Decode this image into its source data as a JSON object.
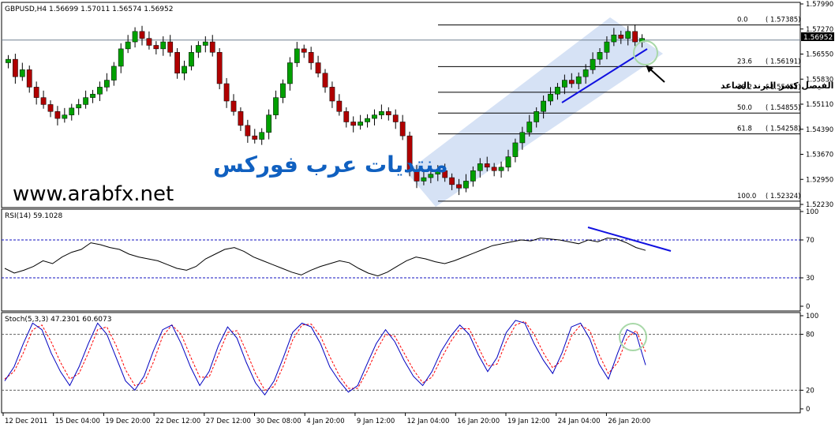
{
  "colors": {
    "background": "#ffffff",
    "candle_bull": "#00a000",
    "candle_bear": "#b00000",
    "candle_wick": "#000000",
    "channel_fill": "#c8d8f2",
    "trendline": "#1010e0",
    "fib_line": "#000000",
    "price_line": "#708090",
    "rsi_line": "#000000",
    "stoch_main": "#0000c0",
    "stoch_signal": "#ff0000",
    "level_dash": "#1010c0",
    "circle": "#a8d8a8",
    "watermark_arabic": "#1060c0",
    "watermark_url": "#000000"
  },
  "price_panel": {
    "header": "GBPUSD,H4  1.56699 1.57011 1.56574 1.56952",
    "current_price_label": "1.56952",
    "annotation": "الفيصل كسر الترند الصاعد",
    "watermark_arabic": "منتديات عرب فوركس",
    "watermark_url": "www.arabfx.net"
  },
  "rsi_panel": {
    "header": "RSI(14) 59.1028"
  },
  "stoch_panel": {
    "header": "Stoch(5,3,3) 47.2301 60.6073"
  },
  "chart_data": [
    {
      "type": "candlestick",
      "symbol": "GBPUSD",
      "timeframe": "H4",
      "ylim": [
        1.5223,
        1.5799
      ],
      "y_ticks": [
        "1.57990",
        "1.57270",
        "1.56550",
        "1.55830",
        "1.55110",
        "1.54390",
        "1.53670",
        "1.52950",
        "1.52230"
      ],
      "current_price": 1.56952,
      "fibonacci": [
        {
          "level": "0.0",
          "price": "1.57385",
          "value": 1.57385
        },
        {
          "level": "23.6",
          "price": "1.56191",
          "value": 1.56191
        },
        {
          "level": "38.2",
          "price": "1.55452",
          "value": 1.55452
        },
        {
          "level": "50.0",
          "price": "1.54855",
          "value": 1.54855
        },
        {
          "level": "61.8",
          "price": "1.54258",
          "value": 1.54258
        },
        {
          "level": "100.0",
          "price": "1.52324",
          "value": 1.52324
        }
      ],
      "close_series_approx": [
        1.564,
        1.559,
        1.561,
        1.556,
        1.553,
        1.551,
        1.549,
        1.547,
        1.548,
        1.55,
        1.551,
        1.553,
        1.554,
        1.556,
        1.558,
        1.562,
        1.567,
        1.569,
        1.572,
        1.57,
        1.568,
        1.567,
        1.569,
        1.566,
        1.56,
        1.562,
        1.566,
        1.568,
        1.569,
        1.566,
        1.557,
        1.552,
        1.549,
        1.545,
        1.542,
        1.541,
        1.543,
        1.548,
        1.553,
        1.557,
        1.563,
        1.567,
        1.566,
        1.563,
        1.56,
        1.556,
        1.552,
        1.549,
        1.546,
        1.545,
        1.546,
        1.547,
        1.548,
        1.549,
        1.548,
        1.546,
        1.542,
        1.532,
        1.529,
        1.53,
        1.531,
        1.532,
        1.53,
        1.528,
        1.527,
        1.529,
        1.532,
        1.534,
        1.533,
        1.532,
        1.533,
        1.536,
        1.54,
        1.543,
        1.546,
        1.549,
        1.552,
        1.554,
        1.556,
        1.558,
        1.557,
        1.559,
        1.561,
        1.564,
        1.566,
        1.569,
        1.571,
        1.57,
        1.572,
        1.569,
        1.57
      ]
    },
    {
      "type": "line",
      "name": "RSI(14)",
      "value": 59.1028,
      "ylim": [
        0,
        100
      ],
      "y_ticks": [
        "100",
        "70",
        "30",
        "0"
      ],
      "levels": [
        70,
        30
      ],
      "values_approx": [
        40,
        35,
        38,
        42,
        48,
        45,
        52,
        57,
        60,
        67,
        65,
        62,
        60,
        55,
        52,
        50,
        48,
        44,
        40,
        38,
        42,
        50,
        55,
        60,
        62,
        58,
        52,
        48,
        44,
        40,
        36,
        33,
        38,
        42,
        45,
        48,
        46,
        40,
        35,
        32,
        36,
        42,
        48,
        52,
        50,
        47,
        45,
        48,
        52,
        56,
        60,
        64,
        66,
        68,
        70,
        69,
        72,
        71,
        70,
        68,
        66,
        70,
        68,
        72,
        71,
        67,
        62,
        59
      ]
    },
    {
      "type": "line",
      "name": "Stoch(5,3,3)",
      "main": 47.2301,
      "signal": 60.6073,
      "ylim": [
        0,
        100
      ],
      "y_ticks": [
        "100",
        "80",
        "20",
        "0"
      ],
      "levels": [
        80,
        20
      ],
      "main_values_approx": [
        30,
        45,
        70,
        92,
        85,
        60,
        40,
        25,
        45,
        70,
        92,
        80,
        55,
        30,
        20,
        35,
        62,
        85,
        90,
        70,
        45,
        25,
        40,
        68,
        88,
        76,
        50,
        28,
        15,
        30,
        55,
        82,
        92,
        88,
        70,
        45,
        30,
        18,
        25,
        48,
        70,
        85,
        72,
        52,
        35,
        25,
        40,
        62,
        78,
        90,
        80,
        58,
        40,
        55,
        82,
        95,
        92,
        70,
        52,
        38,
        60,
        88,
        92,
        75,
        48,
        32,
        60,
        85,
        80,
        47
      ],
      "signal_values_approx": [
        32,
        40,
        60,
        85,
        90,
        72,
        50,
        32,
        38,
        60,
        85,
        88,
        68,
        42,
        25,
        28,
        50,
        78,
        90,
        80,
        56,
        34,
        34,
        58,
        82,
        84,
        62,
        38,
        20,
        24,
        46,
        74,
        90,
        91,
        78,
        56,
        36,
        22,
        22,
        40,
        62,
        80,
        78,
        60,
        42,
        28,
        34,
        54,
        72,
        86,
        86,
        66,
        46,
        48,
        72,
        90,
        94,
        80,
        60,
        44,
        52,
        78,
        90,
        84,
        58,
        38,
        50,
        76,
        84,
        61
      ]
    }
  ],
  "x_axis_labels": [
    "12 Dec 2011",
    "15 Dec 04:00",
    "19 Dec 20:00",
    "22 Dec 12:00",
    "27 Dec 12:00",
    "30 Dec 08:00",
    "4 Jan 20:00",
    "9 Jan 12:00",
    "12 Jan 04:00",
    "16 Jan 20:00",
    "19 Jan 12:00",
    "24 Jan 04:00",
    "26 Jan 20:00"
  ]
}
